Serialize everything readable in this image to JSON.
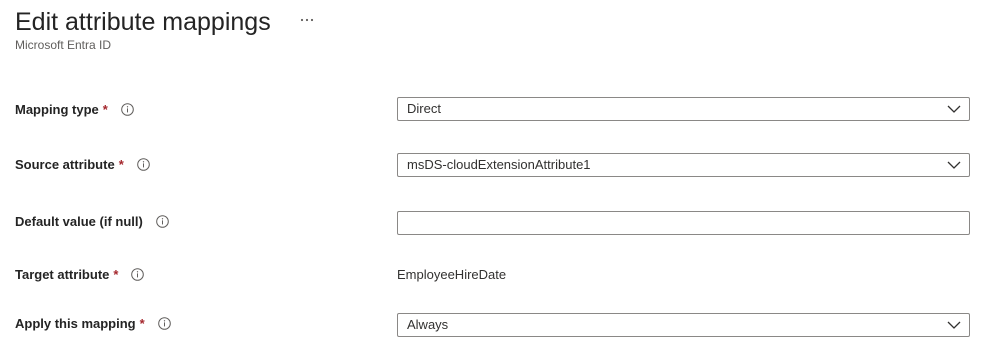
{
  "header": {
    "title": "Edit attribute mappings",
    "subtitle": "Microsoft Entra ID",
    "more_icon": "more-horizontal-icon"
  },
  "form": {
    "required_marker": "*",
    "required_color": "#a4262c",
    "info_icon": "info-icon",
    "mapping_type": {
      "label": "Mapping type",
      "value": "Direct"
    },
    "source_attribute": {
      "label": "Source attribute",
      "value": "msDS-cloudExtensionAttribute1"
    },
    "default_value": {
      "label": "Default value (if null)",
      "value": ""
    },
    "target_attribute": {
      "label": "Target attribute",
      "value": "EmployeeHireDate"
    },
    "apply_mapping": {
      "label": "Apply this mapping",
      "value": "Always"
    }
  }
}
